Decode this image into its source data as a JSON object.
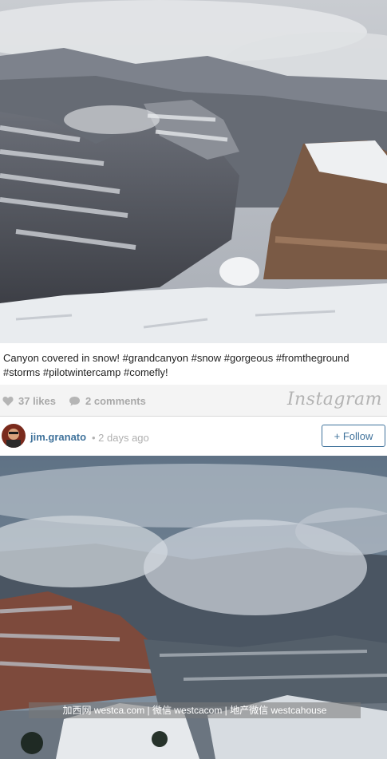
{
  "post": {
    "caption": "Canyon covered in snow! #grandcanyon #snow #gorgeous #fromtheground #storms #pilotwintercamp #comefly!",
    "likes": "37 likes",
    "comments": "2 comments",
    "brand": "Instagram"
  },
  "author": {
    "username": "jim.granato",
    "time_ago": "• 2 days ago",
    "follow_label": "+ Follow"
  },
  "watermark": "加西网 westca.com | 微信 westcacom | 地产微信 westcahouse",
  "colors": {
    "link_blue": "#3f729b",
    "muted_gray": "#a9a9a9",
    "stats_bg": "#f4f4f4"
  },
  "icons": {
    "likes": "heart-icon",
    "comments": "speech-bubble-icon"
  }
}
